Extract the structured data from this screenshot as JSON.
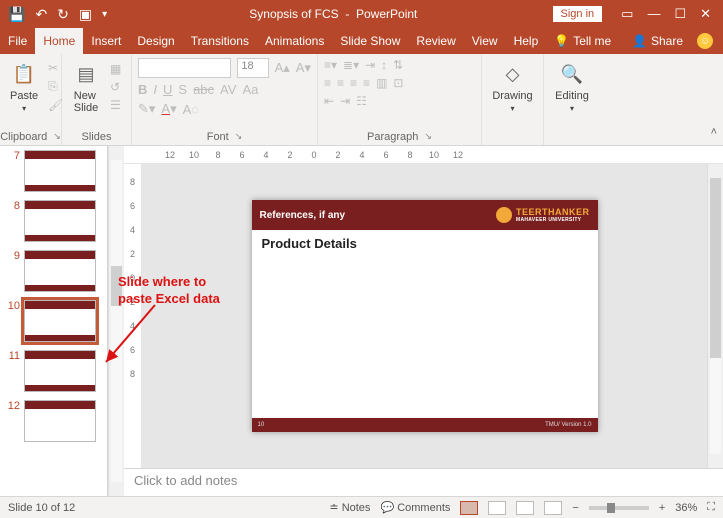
{
  "titlebar": {
    "doc_name": "Synopsis of FCS",
    "app_name": "PowerPoint",
    "signin": "Sign in"
  },
  "tabs": {
    "file": "File",
    "home": "Home",
    "insert": "Insert",
    "design": "Design",
    "transitions": "Transitions",
    "animations": "Animations",
    "slideshow": "Slide Show",
    "review": "Review",
    "view": "View",
    "help": "Help",
    "tellme": "Tell me",
    "share": "Share"
  },
  "ribbon": {
    "paste": "Paste",
    "clipboard": "Clipboard",
    "newslide": "New\nSlide",
    "slides": "Slides",
    "font": "Font",
    "font_size": "18",
    "paragraph": "Paragraph",
    "drawing": "Drawing",
    "editing": "Editing"
  },
  "thumbs": {
    "n7": "7",
    "n8": "8",
    "n9": "9",
    "n10": "10",
    "n11": "11",
    "n12": "12"
  },
  "hruler": [
    "12",
    "10",
    "8",
    "6",
    "4",
    "2",
    "0",
    "2",
    "4",
    "6",
    "8",
    "10",
    "12"
  ],
  "vruler": [
    "8",
    "6",
    "4",
    "2",
    "0",
    "2",
    "4",
    "6",
    "8"
  ],
  "slide": {
    "header": "References, if any",
    "brand_top": "TEERTHANKER",
    "brand_sub": "MAHAVEER UNIVERSITY",
    "title": "Product Details",
    "page": "10",
    "footer_right": "TMU/ Version 1.0"
  },
  "annotation": "Slide where to paste Excel data",
  "notes_placeholder": "Click to add notes",
  "status": {
    "slide_of": "Slide 10 of 12",
    "notes": "Notes",
    "comments": "Comments",
    "zoom": "36%"
  }
}
